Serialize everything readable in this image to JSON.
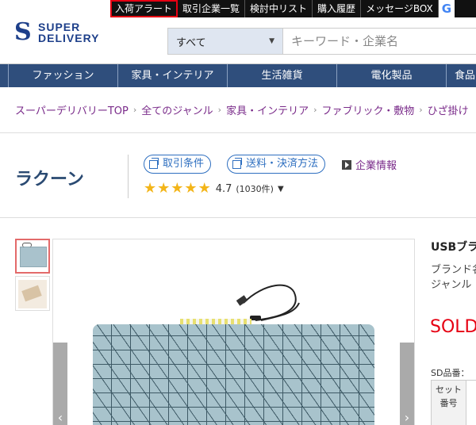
{
  "topbar": {
    "links": [
      "入荷アラート",
      "取引企業一覧",
      "検討中リスト",
      "購入履歴",
      "メッセージBOX"
    ],
    "google_label": "G"
  },
  "header": {
    "logo_line1": "SUPER",
    "logo_line2": "DELIVERY",
    "search_category": "すべて",
    "search_placeholder": "キーワード・企業名"
  },
  "categories": [
    "ファッション",
    "家具・インテリア",
    "生活雑貨",
    "電化製品",
    "食品"
  ],
  "breadcrumb": [
    "スーパーデリバリーTOP",
    "全てのジャンル",
    "家具・インテリア",
    "ファブリック・敷物",
    "ひざ掛け"
  ],
  "shop": {
    "name": "ラクーン",
    "terms_label": "取引条件",
    "shipping_label": "送料・決済方法",
    "company_info_label": "企業情報",
    "rating": 4.7,
    "rating_text": "4.7",
    "review_count": "(1030件)",
    "stars_filled": 5
  },
  "product": {
    "title": "USBブラ",
    "brand_label": "ブランド名",
    "genre_label": "ジャンル",
    "status": "SOLD",
    "sd_number_label": "SD品番：",
    "set_header": "セット番号"
  },
  "colors": {
    "nav_bg": "#2f4e7c",
    "accent_blue": "#2e6fc0",
    "breadcrumb_purple": "#7a2b8a",
    "sold_red": "#e60012",
    "star": "#f3b519"
  },
  "icons": [
    "logo-s-icon",
    "chevron-down-icon",
    "window-icon",
    "play-icon",
    "star-icon",
    "chevron-left-icon",
    "chevron-right-icon"
  ]
}
